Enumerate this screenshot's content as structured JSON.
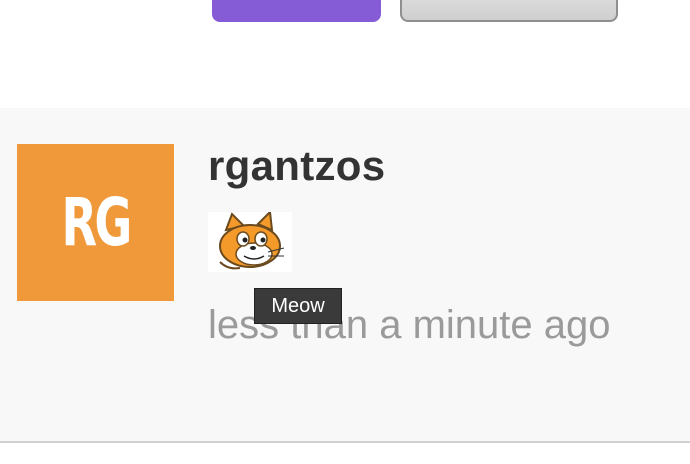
{
  "colors": {
    "primary_button": "#855cd6",
    "avatar_background": "#f0993a",
    "card_background": "#f8f8f8"
  },
  "comment": {
    "author": {
      "username": "rgantzos",
      "avatar_initials": "RG"
    },
    "content": {
      "emoji": "cat-emoji-icon",
      "emoji_tooltip": "Meow"
    },
    "timestamp": "less than a minute ago"
  }
}
